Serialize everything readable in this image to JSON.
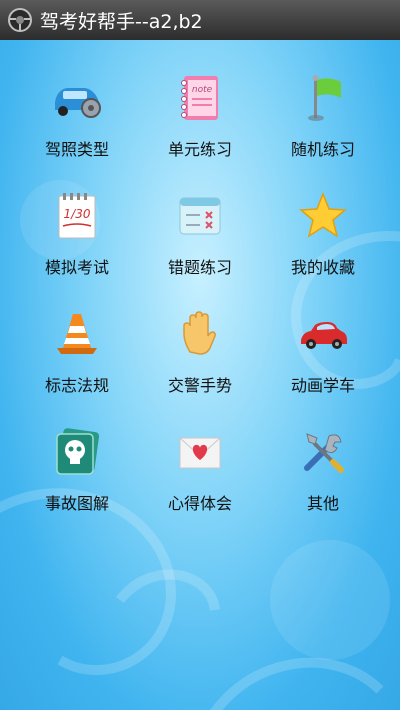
{
  "app": {
    "title": "驾考好帮手--a2,b2"
  },
  "menu": [
    {
      "label": "驾照类型",
      "icon": "car-settings-icon"
    },
    {
      "label": "单元练习",
      "icon": "notebook-icon"
    },
    {
      "label": "随机练习",
      "icon": "flag-icon"
    },
    {
      "label": "模拟考试",
      "icon": "exam-paper-icon"
    },
    {
      "label": "错题练习",
      "icon": "wrong-answers-card-icon"
    },
    {
      "label": "我的收藏",
      "icon": "star-icon"
    },
    {
      "label": "标志法规",
      "icon": "traffic-cone-icon"
    },
    {
      "label": "交警手势",
      "icon": "hand-gesture-icon"
    },
    {
      "label": "动画学车",
      "icon": "red-car-icon"
    },
    {
      "label": "事故图解",
      "icon": "skull-card-icon"
    },
    {
      "label": "心得体会",
      "icon": "heart-envelope-icon"
    },
    {
      "label": "其他",
      "icon": "tools-icon"
    }
  ],
  "colors": {
    "titlebar": "#3a3a3a",
    "background": "#3fb2ee",
    "text": "#111111"
  }
}
